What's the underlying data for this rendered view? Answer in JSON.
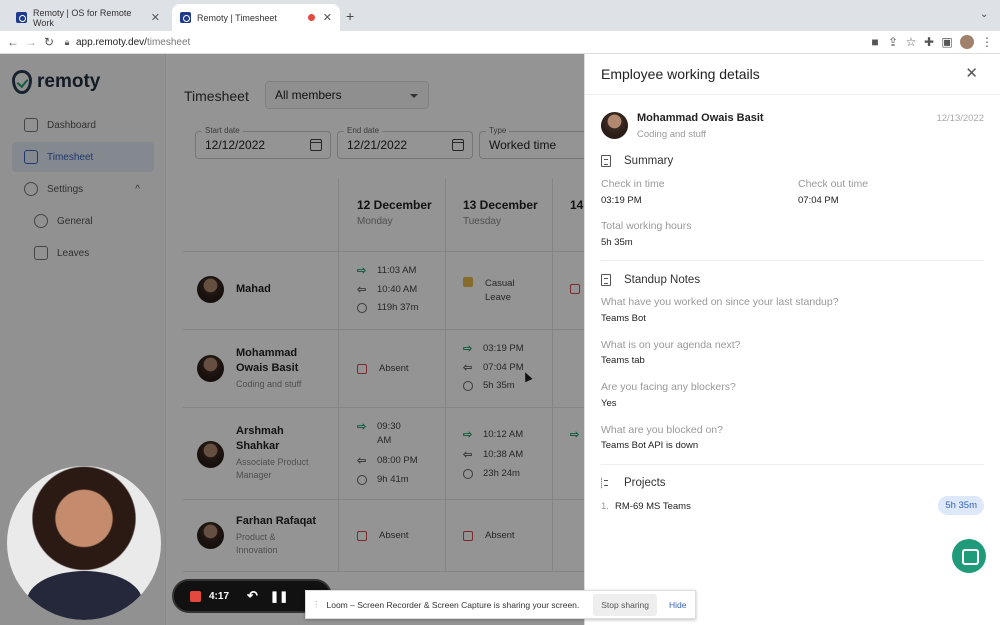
{
  "browser": {
    "tabs": [
      {
        "title": "Remoty | OS for Remote Work"
      },
      {
        "title": "Remoty | Timesheet"
      }
    ],
    "url_host": "app.remoty.dev/",
    "url_path": "timesheet"
  },
  "brand": {
    "name": "remoty"
  },
  "sidebar": {
    "items": [
      {
        "label": "Dashboard"
      },
      {
        "label": "Timesheet"
      },
      {
        "label": "Settings"
      },
      {
        "label": "General"
      },
      {
        "label": "Leaves"
      }
    ]
  },
  "header": {
    "title": "Timesheet",
    "members_filter": "All members"
  },
  "filters": {
    "start_label": "Start date",
    "start_value": "12/12/2022",
    "end_label": "End date",
    "end_value": "12/21/2022",
    "type_label": "Type",
    "type_value": "Worked time"
  },
  "days": [
    {
      "date": "12 December",
      "weekday": "Monday"
    },
    {
      "date": "13 December",
      "weekday": "Tuesday"
    },
    {
      "date": "14"
    }
  ],
  "employees": [
    {
      "name": "Mahad",
      "role": "",
      "mon": {
        "in": "11:03 AM",
        "out": "10:40 AM",
        "total": "119h 37m"
      },
      "tue": {
        "status": "Casual Leave"
      }
    },
    {
      "name": "Mohammad Owais Basit",
      "role": "Coding and stuff",
      "mon": {
        "status": "Absent"
      },
      "tue": {
        "in": "03:19 PM",
        "out": "07:04 PM",
        "total": "5h 35m"
      }
    },
    {
      "name": "Arshmah Shahkar",
      "role": "Associate Product Manager",
      "mon": {
        "in": "09:30 AM",
        "out": "08:00 PM",
        "total": "9h 41m"
      },
      "tue": {
        "in": "10:12 AM",
        "out": "10:38 AM",
        "total": "23h 24m"
      }
    },
    {
      "name": "Farhan Rafaqat",
      "role": "Product & Innovation",
      "mon": {
        "status": "Absent"
      },
      "tue": {
        "status": "Absent"
      }
    }
  ],
  "panel": {
    "title": "Employee working details",
    "employee_name": "Mohammad Owais Basit",
    "employee_role": "Coding and stuff",
    "date": "12/13/2022",
    "summary_heading": "Summary",
    "check_in_label": "Check in time",
    "check_in_value": "03:19 PM",
    "check_out_label": "Check out time",
    "check_out_value": "07:04 PM",
    "total_label": "Total working hours",
    "total_value": "5h 35m",
    "standup_heading": "Standup Notes",
    "standup": [
      {
        "q": "What have you worked on since your last standup?",
        "a": "Teams Bot"
      },
      {
        "q": "What is on your agenda next?",
        "a": "Teams tab"
      },
      {
        "q": "Are you facing any blockers?",
        "a": "Yes"
      },
      {
        "q": "What are you blocked on?",
        "a": "Teams Bot API is down"
      }
    ],
    "projects_heading": "Projects",
    "project_index": "1.",
    "project_name": "RM-69 MS Teams",
    "project_hours": "5h 35m"
  },
  "loom": {
    "timer": "4:17",
    "share_message": "Loom – Screen Recorder & Screen Capture is sharing your screen.",
    "stop_label": "Stop sharing",
    "hide_label": "Hide"
  }
}
